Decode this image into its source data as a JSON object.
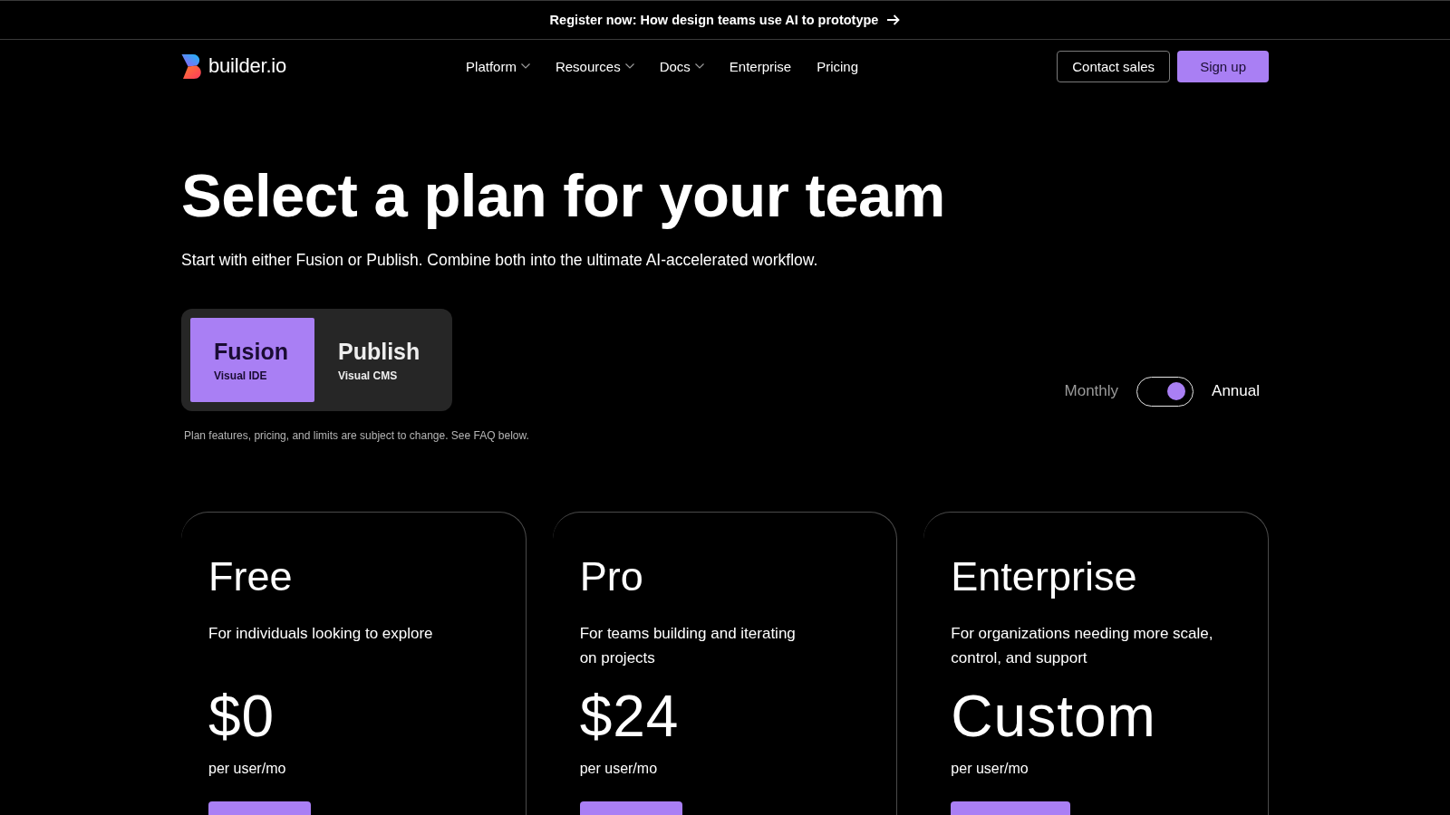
{
  "banner": {
    "text": "Register now: How design teams use AI to prototype"
  },
  "nav": {
    "logo": "builder.io",
    "links": [
      {
        "label": "Platform",
        "dropdown": true
      },
      {
        "label": "Resources",
        "dropdown": true
      },
      {
        "label": "Docs",
        "dropdown": true
      },
      {
        "label": "Enterprise",
        "dropdown": false
      },
      {
        "label": "Pricing",
        "dropdown": false
      }
    ],
    "buttons": [
      {
        "label": "Contact sales",
        "kind": "outline"
      },
      {
        "label": "Sign up",
        "kind": "primary"
      }
    ]
  },
  "hero": {
    "title": "Select a plan for your team",
    "subtitle": "Start with either Fusion or Publish. Combine both into the ultimate AI-accelerated workflow."
  },
  "products": [
    {
      "name": "Fusion",
      "tagline": "Visual IDE",
      "selected": true
    },
    {
      "name": "Publish",
      "tagline": "Visual CMS",
      "selected": false
    }
  ],
  "billing_toggle": {
    "left_label": "Monthly",
    "right_label": "Annual",
    "on": true
  },
  "note": "Plan features, pricing, and limits are subject to change. See FAQ below.",
  "plans": [
    {
      "name": "Free",
      "description": [
        "For individuals looking to explore"
      ],
      "price": "$0",
      "unit": "per user/mo"
    },
    {
      "name": "Pro",
      "description": [
        "For teams building and iterating",
        "on projects"
      ],
      "price": "$24",
      "unit": "per user/mo"
    },
    {
      "name": "Enterprise",
      "description": [
        "For organizations needing more scale,",
        "control, and support"
      ],
      "price": "Custom",
      "unit": "per user/mo"
    }
  ]
}
